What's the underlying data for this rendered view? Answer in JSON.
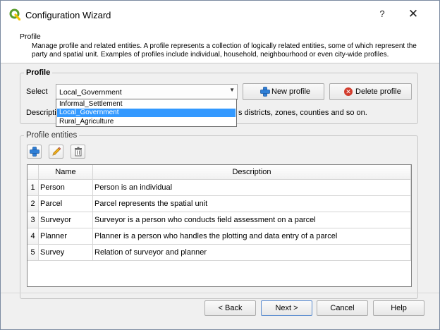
{
  "window": {
    "title": "Configuration Wizard",
    "help_label": "?",
    "close_label": "✕"
  },
  "header": {
    "title": "Profile",
    "description": "Manage profile and related entities.  A profile represents a collection of logically related entities, some of which represent the party and spatial unit. Examples of profiles include individual, household, neighbourhood or even city-wide profiles."
  },
  "profile_group": {
    "title": "Profile",
    "select_label": "Select",
    "selected_value": "Local_Government",
    "new_profile_label": "New profile",
    "delete_profile_label": "Delete profile",
    "description_label_visible": "Descriptio",
    "description_text_visible": "s districts, zones, counties and so on.",
    "dropdown_options": [
      "Informal_Settlement",
      "Local_Government",
      "Rural_Agriculture"
    ],
    "dropdown_highlighted_index": 1
  },
  "entities_group": {
    "title": "Profile entities",
    "table": {
      "columns": [
        "Name",
        "Description"
      ],
      "rows": [
        {
          "num": "1",
          "name": "Person",
          "description": "Person is an individual"
        },
        {
          "num": "2",
          "name": "Parcel",
          "description": "Parcel represents the spatial unit"
        },
        {
          "num": "3",
          "name": "Surveyor",
          "description": "Surveyor is a person who conducts field assessment on a parcel"
        },
        {
          "num": "4",
          "name": "Planner",
          "description": "Planner is a person who handles the plotting and data entry of a parcel"
        },
        {
          "num": "5",
          "name": "Survey",
          "description": "Relation of surveyor and planner"
        }
      ]
    }
  },
  "footer": {
    "back_label": "< Back",
    "next_label": "Next >",
    "cancel_label": "Cancel",
    "help_label": "Help"
  },
  "colors": {
    "accent_blue": "#3399ff",
    "plus_icon_blue": "#2f7fd6",
    "delete_red": "#d23c2d",
    "logo_green": "#5a9e2c",
    "logo_yellow": "#f3c400"
  },
  "icons": {
    "app": "qgis-logo-icon",
    "add": "plus-icon",
    "edit": "pencil-icon",
    "remove": "trash-icon",
    "delete": "delete-circle-icon",
    "dropdown": "chevron-down-icon"
  }
}
